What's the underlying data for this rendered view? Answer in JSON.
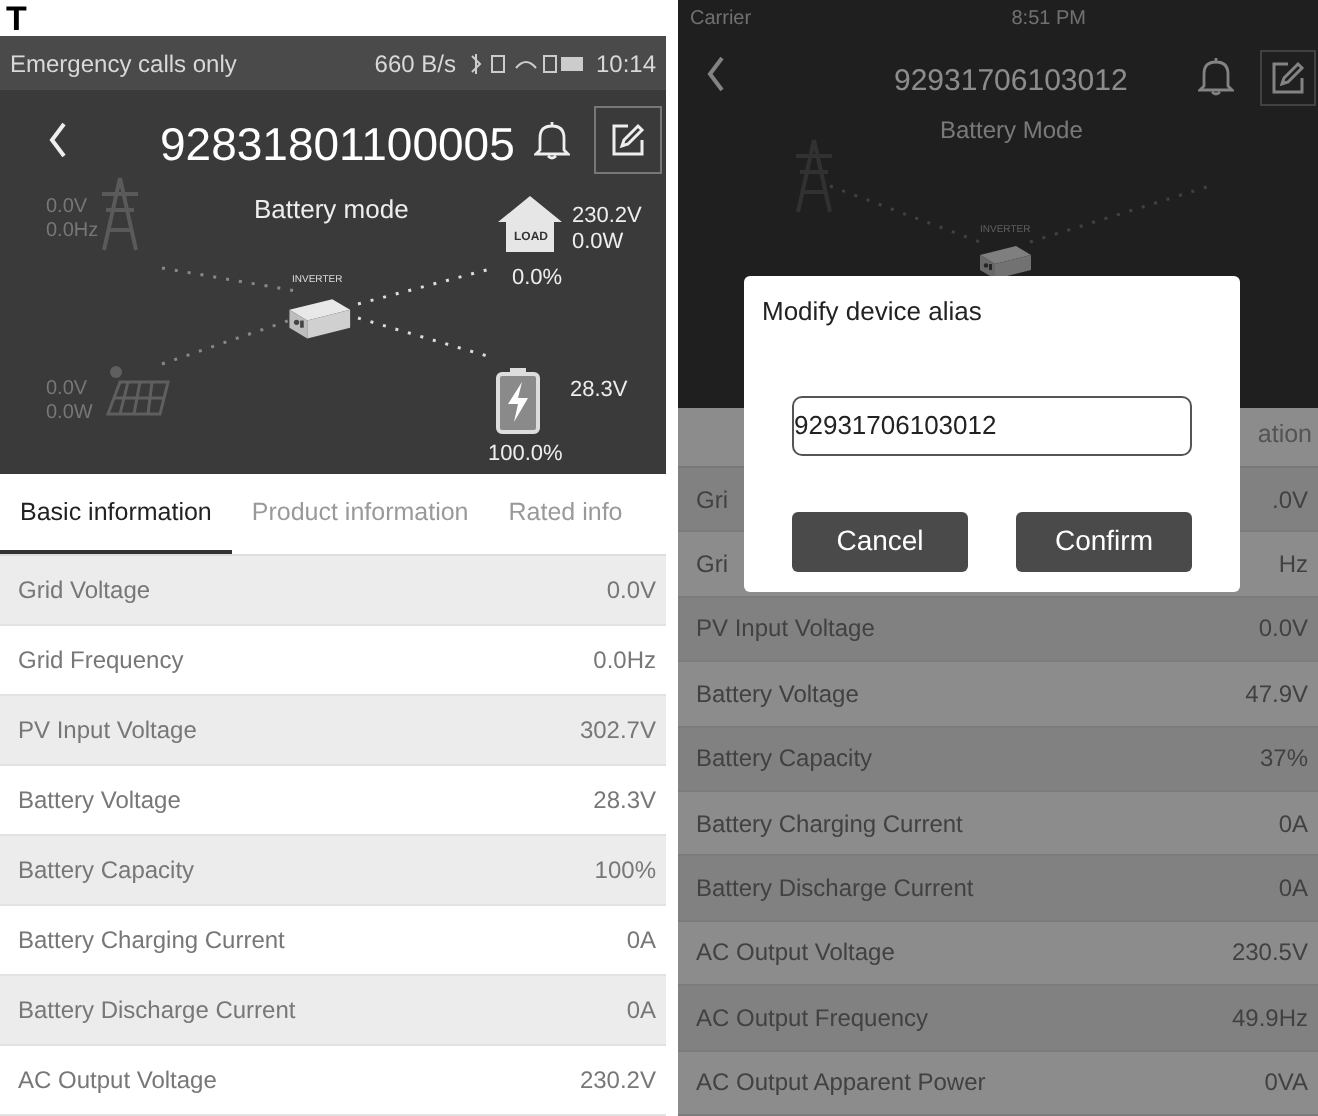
{
  "corner_label": "T",
  "left_phone": {
    "status_bar": {
      "carrier": "Emergency calls only",
      "speed": "660 B/s",
      "time": "10:14"
    },
    "title": "92831801100005",
    "mode": "Battery mode",
    "diagram": {
      "grid_values": [
        "0.0V",
        "0.0Hz"
      ],
      "pv_values": [
        "0.0V",
        "0.0W"
      ],
      "inverter_label": "INVERTER",
      "load_tag": "LOAD",
      "load_values": [
        "230.2V",
        "0.0W"
      ],
      "load_percent": "0.0%",
      "battery_voltage": "28.3V",
      "battery_percent": "100.0%"
    },
    "tabs": [
      {
        "label": "Basic information",
        "selected": true
      },
      {
        "label": "Product information",
        "selected": false
      },
      {
        "label": "Rated info",
        "selected": false
      }
    ],
    "rows": [
      {
        "label": "Grid Voltage",
        "value": "0.0V"
      },
      {
        "label": "Grid Frequency",
        "value": "0.0Hz"
      },
      {
        "label": "PV Input Voltage",
        "value": "302.7V"
      },
      {
        "label": "Battery Voltage",
        "value": "28.3V"
      },
      {
        "label": "Battery Capacity",
        "value": "100%"
      },
      {
        "label": "Battery Charging Current",
        "value": "0A"
      },
      {
        "label": "Battery Discharge Current",
        "value": "0A"
      },
      {
        "label": "AC Output Voltage",
        "value": "230.2V"
      }
    ]
  },
  "right_phone": {
    "status_bar": {
      "carrier": "Carrier",
      "time": "8:51 PM"
    },
    "title": "92931706103012",
    "mode": "Battery Mode",
    "diagram": {
      "inverter_label": "INVERTER"
    },
    "tabs": [
      {
        "label": "ation",
        "selected": false
      }
    ],
    "rows": [
      {
        "label": "Gri",
        "value": ".0V"
      },
      {
        "label": "Gri",
        "value": "Hz"
      },
      {
        "label": "PV Input Voltage",
        "value": "0.0V"
      },
      {
        "label": "Battery Voltage",
        "value": "47.9V"
      },
      {
        "label": "Battery Capacity",
        "value": "37%"
      },
      {
        "label": "Battery Charging Current",
        "value": "0A"
      },
      {
        "label": "Battery Discharge Current",
        "value": "0A"
      },
      {
        "label": "AC Output Voltage",
        "value": "230.5V"
      },
      {
        "label": "AC Output Frequency",
        "value": "49.9Hz"
      },
      {
        "label": "AC Output Apparent Power",
        "value": "0VA"
      }
    ],
    "dialog": {
      "title": "Modify device alias",
      "value": "92931706103012",
      "buttons": [
        "Cancel",
        "Confirm"
      ]
    }
  }
}
